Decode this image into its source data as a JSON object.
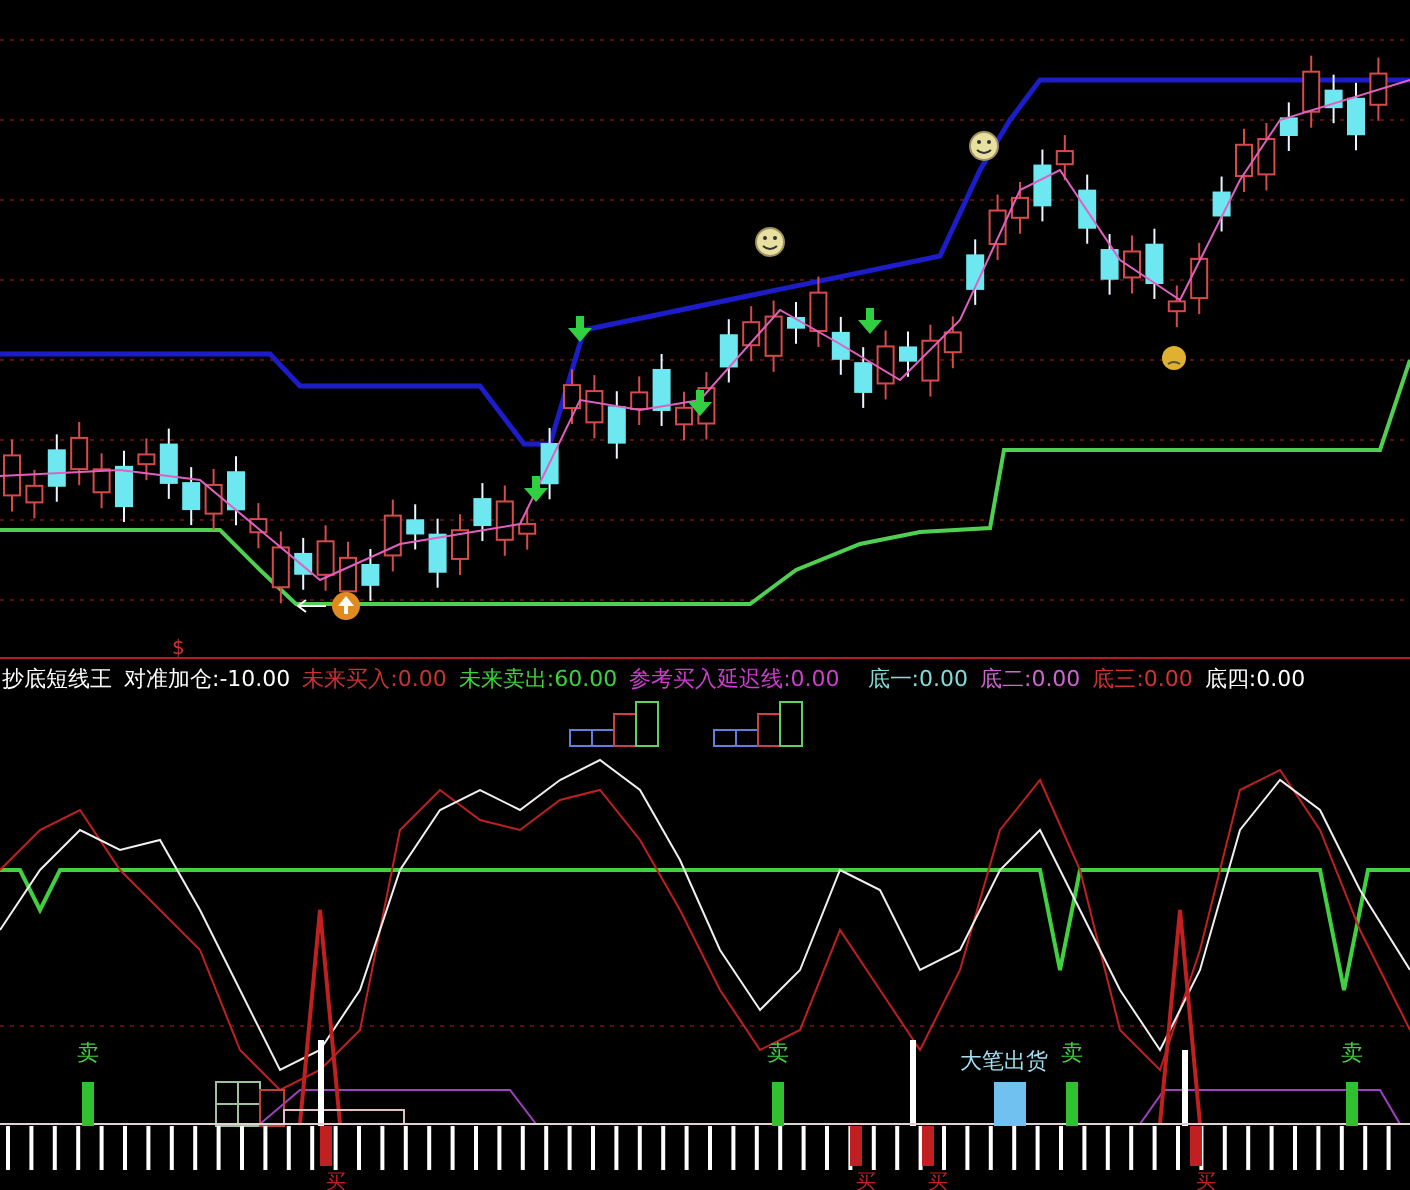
{
  "price_chart": {
    "marker": "$"
  },
  "indicator": {
    "name": "抄底短线王",
    "values": [
      {
        "text": "对准加仓:-10.00",
        "color": "#ffffff"
      },
      {
        "text": "未来买入:0.00",
        "color": "#c83232"
      },
      {
        "text": "未来卖出:60.00",
        "color": "#3cd23c"
      },
      {
        "text": "参考买入延迟线:0.00",
        "color": "#d23cd2"
      },
      {
        "text": "底一:0.00",
        "color": "#82dcdc"
      },
      {
        "text": "底二:0.00",
        "color": "#d264d2"
      },
      {
        "text": "底三:0.00",
        "color": "#d23232"
      },
      {
        "text": "底四:0.00",
        "color": "#ffffff"
      }
    ]
  },
  "signals": [
    {
      "kind": "sell",
      "text": "卖"
    },
    {
      "kind": "buy",
      "text": "买"
    },
    {
      "kind": "sell",
      "text": "卖"
    },
    {
      "kind": "buy",
      "text": "买"
    },
    {
      "kind": "buy",
      "text": "买"
    },
    {
      "kind": "block",
      "text": "大笔出货"
    },
    {
      "kind": "sell",
      "text": "卖"
    },
    {
      "kind": "buy",
      "text": "买"
    },
    {
      "kind": "sell",
      "text": "卖"
    }
  ]
}
